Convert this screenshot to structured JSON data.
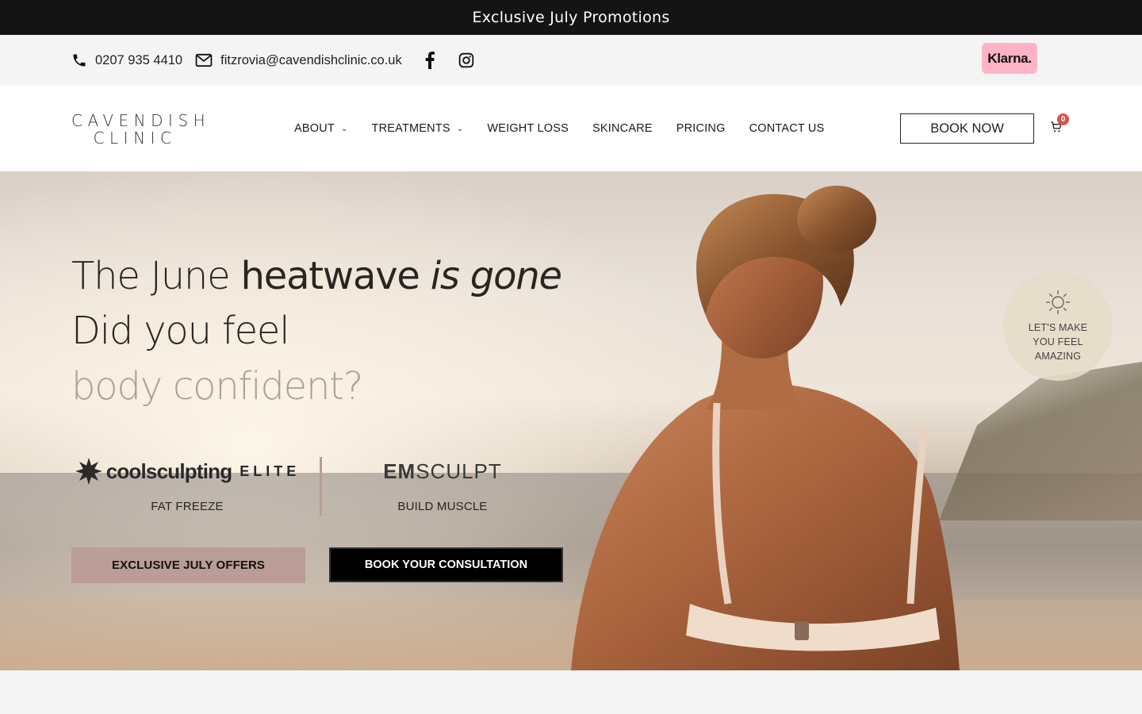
{
  "promo": {
    "text": "Exclusive July Promotions"
  },
  "contact": {
    "phone": "0207 935 4410",
    "email": "fitzrovia@cavendishclinic.co.uk",
    "social": [
      "facebook-icon",
      "instagram-icon"
    ],
    "klarna": "Klarna."
  },
  "nav": {
    "logo_line1": "CAVENDISH",
    "logo_line2": "CLINIC",
    "items": [
      {
        "label": "ABOUT",
        "dropdown": true
      },
      {
        "label": "TREATMENTS",
        "dropdown": true
      },
      {
        "label": "WEIGHT LOSS",
        "dropdown": false
      },
      {
        "label": "SKINCARE",
        "dropdown": false
      },
      {
        "label": "PRICING",
        "dropdown": false
      },
      {
        "label": "CONTACT US",
        "dropdown": false
      }
    ],
    "book_now": "BOOK NOW",
    "cart_count": "0"
  },
  "hero": {
    "line1_a": "The June ",
    "line1_b": "heatwave",
    "line1_c": " is gone",
    "line2": "Did you feel",
    "line3": "body confident?",
    "brands": [
      {
        "name_a": "coolsculpting",
        "name_b": "ELITE",
        "label": "FAT FREEZE"
      },
      {
        "name_a": "EM",
        "name_b": "SCULPT",
        "label": "BUILD MUSCLE"
      }
    ],
    "btn_offers": "EXCLUSIVE JULY OFFERS",
    "btn_consult": "BOOK YOUR CONSULTATION",
    "badge": "LET'S MAKE YOU FEEL AMAZING",
    "colors": {
      "accent": "#b59e94",
      "button_offer": "#b99d96",
      "button_dark": "#000000"
    }
  }
}
